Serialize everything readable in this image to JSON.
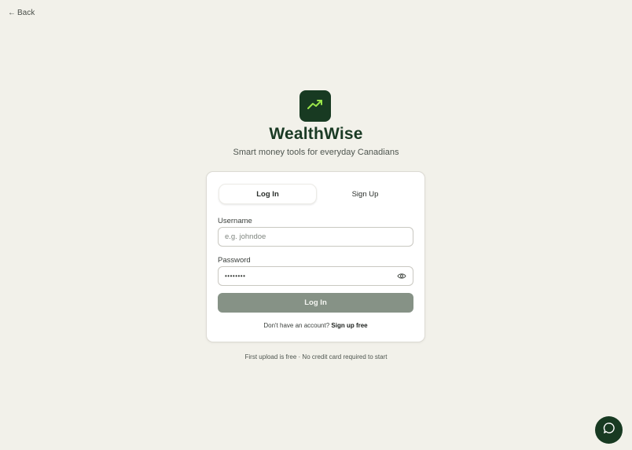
{
  "nav": {
    "back_label": "Back",
    "back_arrow": "←"
  },
  "brand": {
    "name": "WealthWise",
    "tagline": "Smart money tools for everyday Canadians",
    "logo_icon": "trending-up-icon",
    "colors": {
      "brand_dark": "#183a22",
      "accent_green": "#9be64a",
      "button_muted": "#869286"
    }
  },
  "auth": {
    "tabs": [
      {
        "label": "Log In",
        "active": true
      },
      {
        "label": "Sign Up",
        "active": false
      }
    ],
    "username": {
      "label": "Username",
      "placeholder": "e.g. johndoe",
      "value": ""
    },
    "password": {
      "label": "Password",
      "value": "••••••••",
      "toggle_icon": "eye-icon"
    },
    "submit_label": "Log In",
    "signup_prompt": "Don't have an account?",
    "signup_link": "Sign up free"
  },
  "footnote": "First upload is free · No credit card required to start",
  "chat": {
    "icon": "chat-bubble-icon"
  }
}
